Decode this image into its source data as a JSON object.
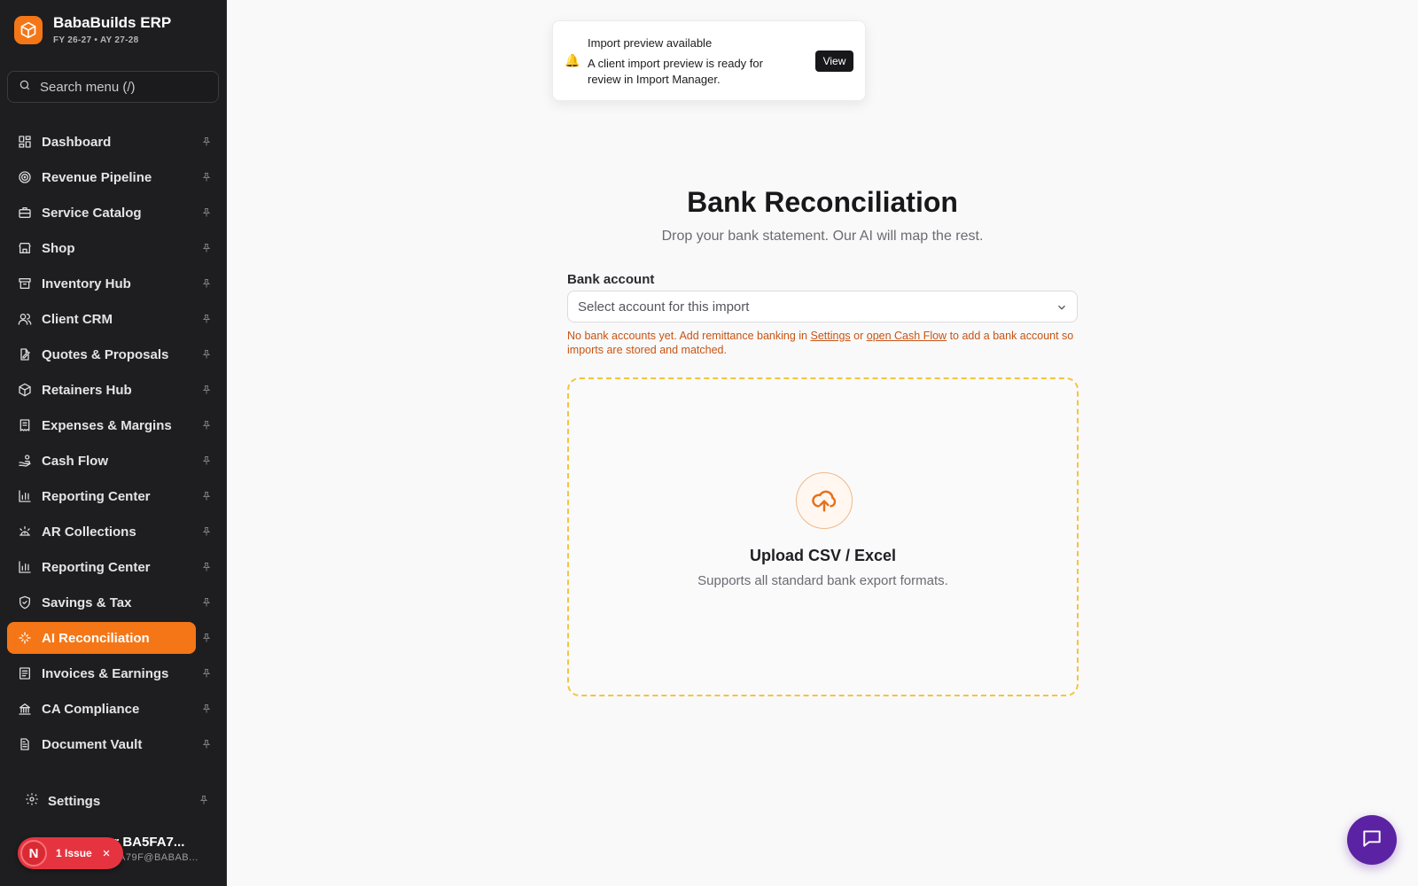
{
  "app": {
    "title": "BabaBuilds ERP",
    "subtitle": "FY 26-27 • AY 27-28"
  },
  "search": {
    "placeholder": "Search menu (/)"
  },
  "sidebar": {
    "items": [
      {
        "label": "Dashboard",
        "icon": "dashboard-icon"
      },
      {
        "label": "Revenue Pipeline",
        "icon": "target-icon"
      },
      {
        "label": "Service Catalog",
        "icon": "briefcase-icon"
      },
      {
        "label": "Shop",
        "icon": "store-icon"
      },
      {
        "label": "Inventory Hub",
        "icon": "archive-icon"
      },
      {
        "label": "Client CRM",
        "icon": "users-icon"
      },
      {
        "label": "Quotes & Proposals",
        "icon": "file-edit-icon"
      },
      {
        "label": "Retainers Hub",
        "icon": "box-icon"
      },
      {
        "label": "Expenses & Margins",
        "icon": "receipt-icon"
      },
      {
        "label": "Cash Flow",
        "icon": "hand-coins-icon"
      },
      {
        "label": "Reporting Center",
        "icon": "bar-chart-icon"
      },
      {
        "label": "AR Collections",
        "icon": "alarm-icon"
      },
      {
        "label": "Reporting Center",
        "icon": "bar-chart-icon"
      },
      {
        "label": "Savings & Tax",
        "icon": "shield-icon"
      },
      {
        "label": "AI Reconciliation",
        "icon": "sparkles-icon",
        "active": true
      },
      {
        "label": "Invoices & Earnings",
        "icon": "invoice-icon"
      },
      {
        "label": "CA Compliance",
        "icon": "landmark-icon"
      },
      {
        "label": "Document Vault",
        "icon": "document-icon"
      }
    ],
    "settings_label": "Settings",
    "accent_color": "#f47617"
  },
  "user": {
    "name": "er BA5FA7...",
    "email": "A79F@BABAB..."
  },
  "issue": {
    "avatar_letter": "N",
    "label": "1 Issue"
  },
  "toast": {
    "title": "Import preview available",
    "body": "A client import preview is ready for review in Import Manager.",
    "button": "View",
    "icon": "bell-icon"
  },
  "page": {
    "title": "Bank Reconciliation",
    "subtitle": "Drop your bank statement. Our AI will map the rest."
  },
  "bank_account": {
    "label": "Bank account",
    "placeholder": "Select account for this import",
    "hint_prefix": "No bank accounts yet. Add remittance banking in",
    "hint_settings_link": "Settings",
    "hint_or": "or",
    "hint_cashflow_link": "open Cash Flow",
    "hint_suffix": "to add a bank account so imports are stored and matched."
  },
  "upload": {
    "title": "Upload CSV / Excel",
    "subtitle": "Supports all standard bank export formats.",
    "icon": "cloud-upload-icon"
  },
  "chat": {
    "icon": "chat-icon",
    "color": "#5b23a3"
  }
}
